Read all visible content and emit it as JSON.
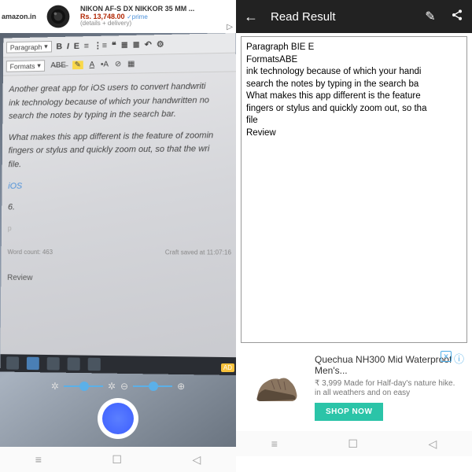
{
  "left": {
    "ad": {
      "brand": "amazon.in",
      "title": "NIKON AF-S DX NIKKOR 35 MM ...",
      "price": "Rs. 13,748.00",
      "prime": "✓prime",
      "subtitle": "(details + delivery)"
    },
    "editor": {
      "para_label": "Paragraph",
      "formats_label": "Formats",
      "content_line1": "Another great app for iOS users to convert handwriti",
      "content_line2": "ink technology because of which your handwritten no",
      "content_line3": "search the notes by typing in the search bar.",
      "content_para2": "What makes this app different is the feature of zoomin",
      "content_para2b": "fingers or stylus and quickly zoom out, so that the wri",
      "content_para2c": "file.",
      "ios": "iOS",
      "listnum": "6.",
      "wordcount": "Word count: 463",
      "saved": "Craft saved at 11:07:16",
      "review": "Review"
    },
    "ad_tag": "AD"
  },
  "right": {
    "title": "Read Result",
    "result": {
      "l1": "Paragraph BIE E",
      "l2": "FormatsABE",
      "l3": "ink technology because of which your handi",
      "l4": "search the notes by typing in the search ba",
      "l5": "What makes this app different is the feature",
      "l6": "fingers or stylus and quickly zoom out, so tha",
      "l7": "file",
      "l8": "Review"
    },
    "ad": {
      "name": "Quechua NH300 Mid Waterproof Men's...",
      "desc": "₹ 3,999 Made for Half-day's nature hike. in all weathers and on easy",
      "cta": "SHOP NOW"
    }
  },
  "nav": {
    "menu": "≡",
    "home": "☐",
    "back": "◁"
  }
}
